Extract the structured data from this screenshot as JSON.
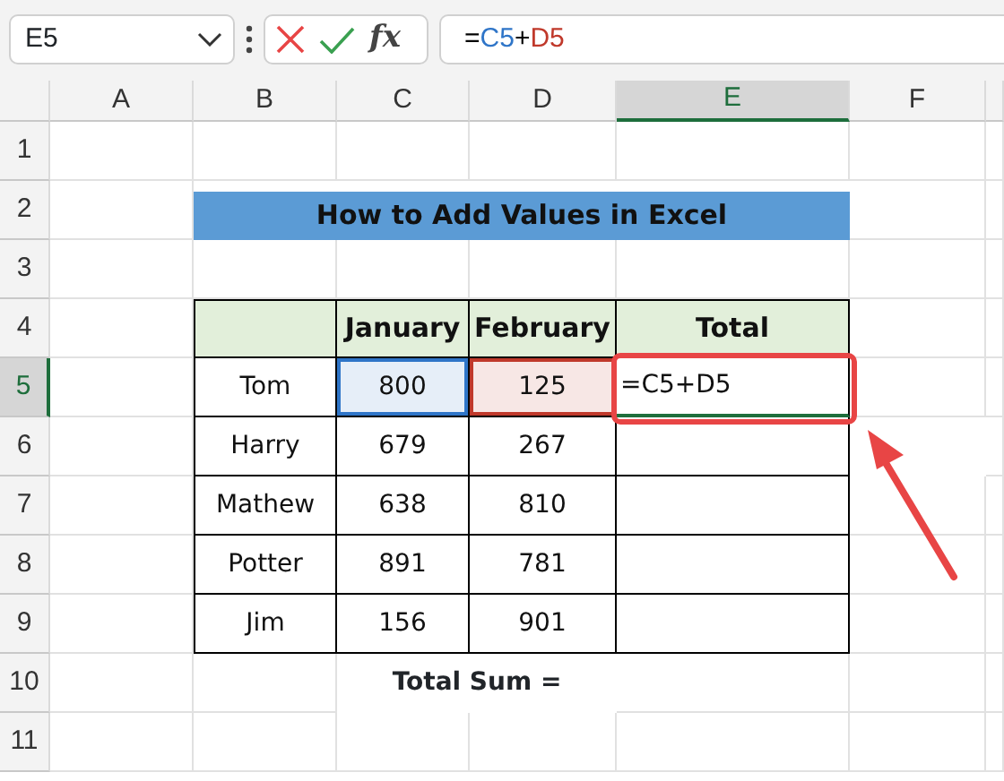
{
  "name_box": {
    "value": "E5"
  },
  "formula_bar": {
    "fx": "fx",
    "formula": [
      {
        "text": "=",
        "color": "#000000"
      },
      {
        "text": "C5",
        "color": "#2f75c8"
      },
      {
        "text": "+",
        "color": "#000000"
      },
      {
        "text": "D5",
        "color": "#c0392b"
      }
    ]
  },
  "columns": [
    {
      "label": "A",
      "selected": false
    },
    {
      "label": "B",
      "selected": false
    },
    {
      "label": "C",
      "selected": false
    },
    {
      "label": "D",
      "selected": false
    },
    {
      "label": "E",
      "selected": true
    },
    {
      "label": "F",
      "selected": false
    }
  ],
  "rows": [
    {
      "label": "1",
      "selected": false
    },
    {
      "label": "2",
      "selected": false
    },
    {
      "label": "3",
      "selected": false
    },
    {
      "label": "4",
      "selected": false
    },
    {
      "label": "5",
      "selected": true
    },
    {
      "label": "6",
      "selected": false
    },
    {
      "label": "7",
      "selected": false
    },
    {
      "label": "8",
      "selected": false
    },
    {
      "label": "9",
      "selected": false
    },
    {
      "label": "10",
      "selected": false
    },
    {
      "label": "11",
      "selected": false
    }
  ],
  "title": "How to Add Values in Excel",
  "table": {
    "columns": [
      "",
      "January",
      "February",
      "Total"
    ],
    "rows": [
      [
        {
          "text": "Tom"
        },
        {
          "text": "800",
          "color": "#2f75c8"
        },
        {
          "text": "125",
          "color": "#c0392b"
        },
        {
          "text": "=C5+D5",
          "active": true
        }
      ],
      [
        {
          "text": "Harry"
        },
        {
          "text": "679"
        },
        {
          "text": "267"
        },
        {
          "text": ""
        }
      ],
      [
        {
          "text": "Mathew"
        },
        {
          "text": "638"
        },
        {
          "text": "810"
        },
        {
          "text": ""
        }
      ],
      [
        {
          "text": "Potter"
        },
        {
          "text": "891"
        },
        {
          "text": "781"
        },
        {
          "text": ""
        }
      ],
      [
        {
          "text": "Jim"
        },
        {
          "text": "156"
        },
        {
          "text": "901"
        },
        {
          "text": ""
        }
      ]
    ]
  },
  "total_label": "Total Sum ="
}
